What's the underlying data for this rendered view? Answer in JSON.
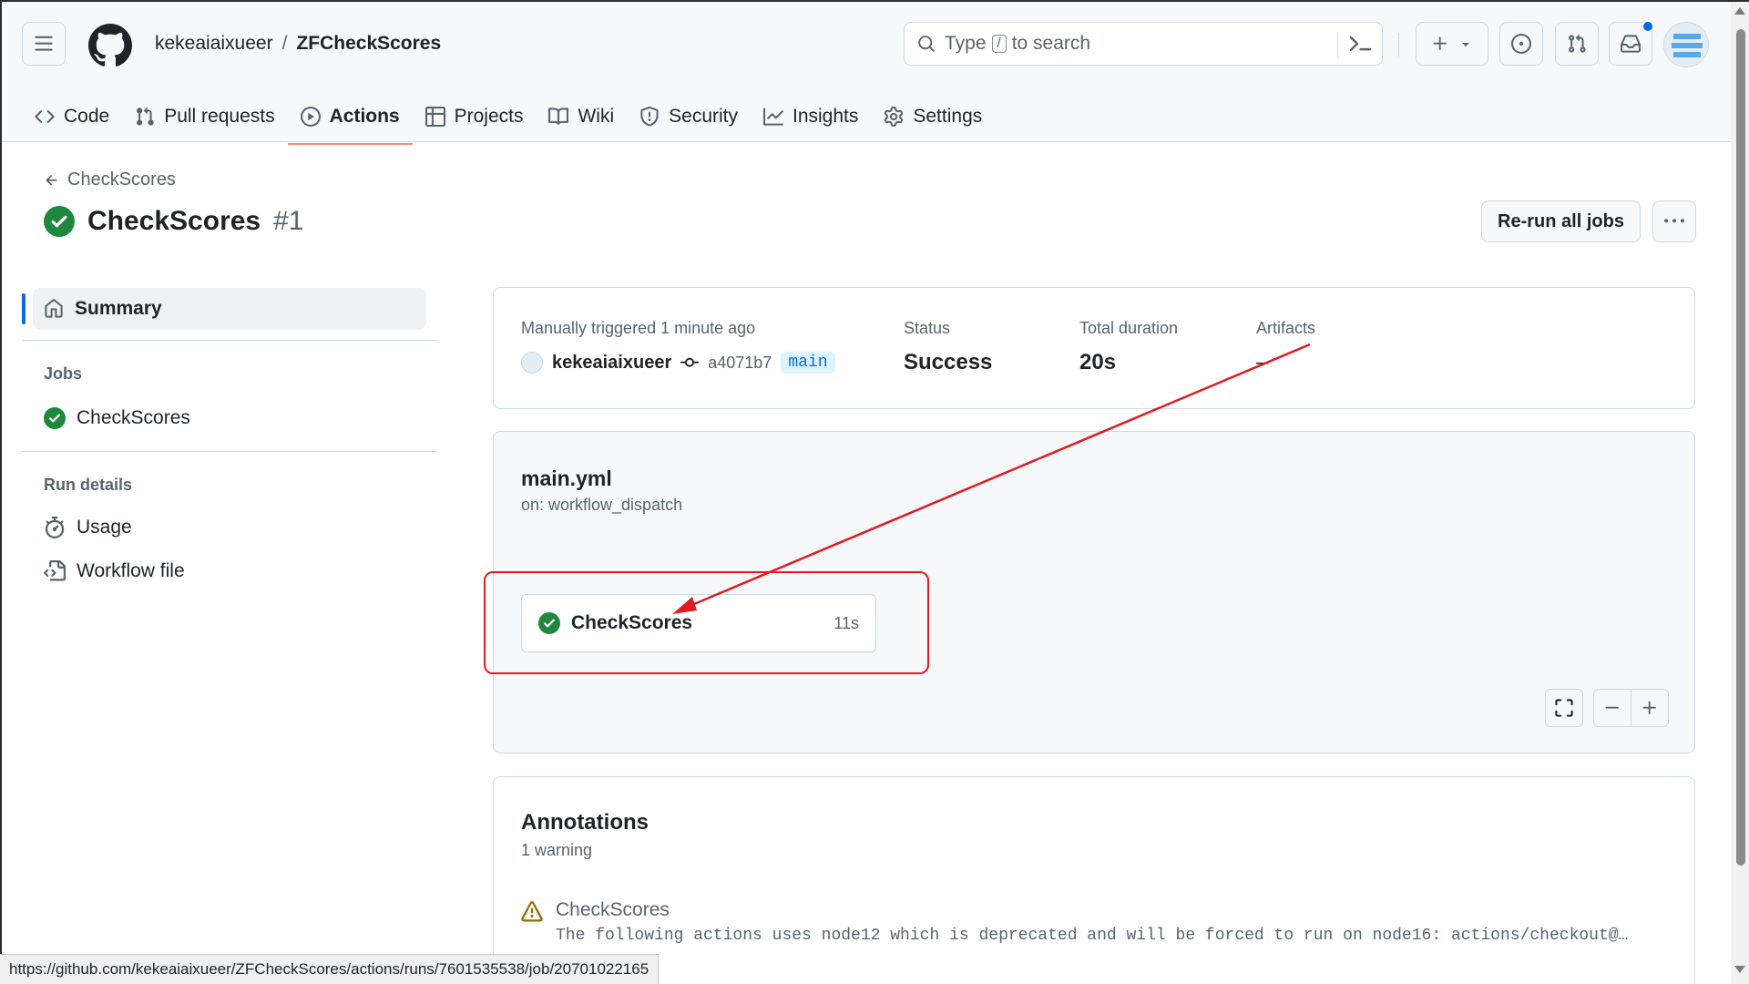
{
  "repo": {
    "owner": "kekeaiaixueer",
    "name": "ZFCheckScores"
  },
  "search": {
    "prefix": "Type",
    "key": "/",
    "suffix": "to search"
  },
  "tabs": [
    {
      "label": "Code",
      "icon": "code-icon"
    },
    {
      "label": "Pull requests",
      "icon": "git-pull-request-icon"
    },
    {
      "label": "Actions",
      "icon": "play-icon",
      "active": true
    },
    {
      "label": "Projects",
      "icon": "table-icon"
    },
    {
      "label": "Wiki",
      "icon": "book-icon"
    },
    {
      "label": "Security",
      "icon": "shield-icon"
    },
    {
      "label": "Insights",
      "icon": "graph-icon"
    },
    {
      "label": "Settings",
      "icon": "gear-icon"
    }
  ],
  "run": {
    "back_label": "CheckScores",
    "title": "CheckScores",
    "number": "#1",
    "rerun_label": "Re-run all jobs"
  },
  "sidebar": {
    "summary_label": "Summary",
    "jobs_heading": "Jobs",
    "jobs": [
      "CheckScores"
    ],
    "run_details_heading": "Run details",
    "details": [
      {
        "label": "Usage",
        "icon": "stopwatch-icon"
      },
      {
        "label": "Workflow file",
        "icon": "file-code-icon"
      }
    ]
  },
  "summary": {
    "trigger_text": "Manually triggered 1 minute ago",
    "actor": "kekeaiaixueer",
    "commit": "a4071b7",
    "branch": "main",
    "status_label": "Status",
    "status_value": "Success",
    "duration_label": "Total duration",
    "duration_value": "20s",
    "artifacts_label": "Artifacts",
    "artifacts_value": "–"
  },
  "workflow": {
    "file": "main.yml",
    "trigger": "on: workflow_dispatch",
    "job_name": "CheckScores",
    "job_duration": "11s"
  },
  "annotations": {
    "title": "Annotations",
    "count": "1 warning",
    "warning_title": "CheckScores",
    "warning_message": "The following actions uses node12 which is deprecated and will be forced to run on node16: actions/checkout@…"
  },
  "statusbar_url": "https://github.com/kekeaiaixueer/ZFCheckScores/actions/runs/7601535538/job/20701022165",
  "colors": {
    "success": "#1f883d",
    "accent": "#0969da",
    "tab_underline": "#fd8c73",
    "annotation_red": "#e01b24",
    "warning": "#9a6700"
  }
}
